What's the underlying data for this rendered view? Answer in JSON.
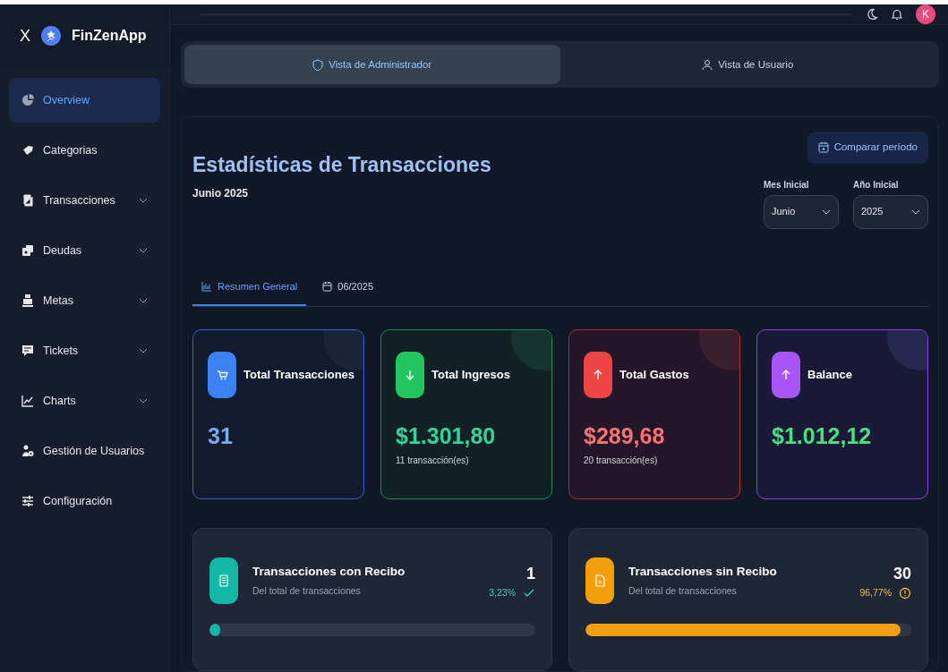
{
  "sidebar": {
    "close": "X",
    "brand": "FinZenApp",
    "items": [
      {
        "label": "Overview",
        "selected": true,
        "expandable": false
      },
      {
        "label": "Categorias",
        "selected": false,
        "expandable": false
      },
      {
        "label": "Transacciones",
        "selected": false,
        "expandable": true
      },
      {
        "label": "Deudas",
        "selected": false,
        "expandable": true
      },
      {
        "label": "Metas",
        "selected": false,
        "expandable": true
      },
      {
        "label": "Tickets",
        "selected": false,
        "expandable": true
      },
      {
        "label": "Charts",
        "selected": false,
        "expandable": true
      },
      {
        "label": "Gestión de Usuarios",
        "selected": false,
        "expandable": false
      },
      {
        "label": "Configuración",
        "selected": false,
        "expandable": false
      }
    ]
  },
  "header": {
    "avatar": "K"
  },
  "view_toggle": [
    {
      "label": "Vista de Administrador",
      "selected": true
    },
    {
      "label": "Vista de Usuario",
      "selected": false
    }
  ],
  "stats": {
    "title": "Estadísticas de Transacciones",
    "subtitle": "Junio 2025",
    "compare_button": "Comparar período",
    "filters": [
      {
        "label": "Mes Inicial",
        "value": "Junio"
      },
      {
        "label": "Año Inicial",
        "value": "2025"
      }
    ],
    "tabs": [
      {
        "label": "Resumen General",
        "selected": true
      },
      {
        "label": "06/2025",
        "selected": false
      }
    ],
    "cards": [
      {
        "kind": "count",
        "title": "Total Transacciones",
        "value": "31"
      },
      {
        "kind": "income",
        "title": "Total Ingresos",
        "value": "$1.301,80",
        "note": "11 transacción(es)"
      },
      {
        "kind": "expense",
        "title": "Total Gastos",
        "value": "$289,68",
        "note": "20 transacción(es)"
      },
      {
        "kind": "balance",
        "title": "Balance",
        "value": "$1.012,12"
      }
    ],
    "receipts": [
      {
        "kind": "with",
        "title": "Transacciones con Recibo",
        "subtitle": "Del total de transacciones",
        "count": "1",
        "percent": "3,23%",
        "level": 0.0323
      },
      {
        "kind": "without",
        "title": "Transacciones sin Recibo",
        "subtitle": "Del total de transacciones",
        "count": "30",
        "percent": "96,77%",
        "level": 0.9677
      }
    ]
  }
}
